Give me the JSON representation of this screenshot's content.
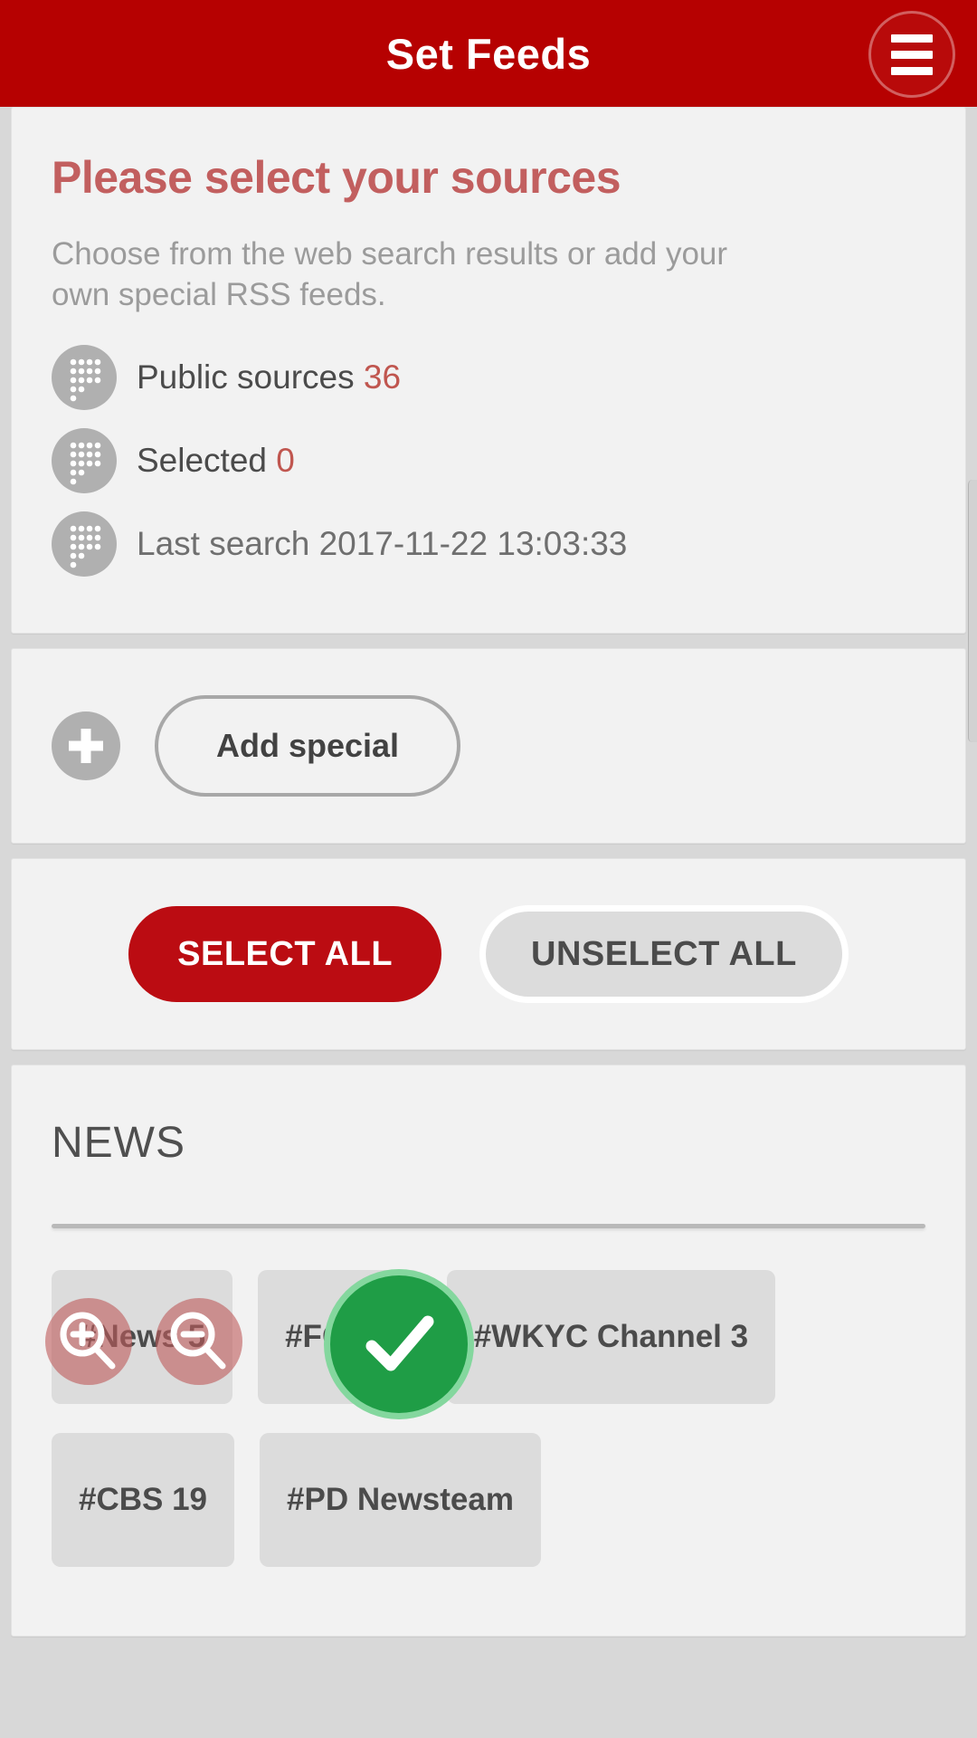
{
  "header": {
    "title": "Set Feeds",
    "menu_icon": "hamburger-menu-icon"
  },
  "intro": {
    "headline": "Please select your sources",
    "subtext": "Choose from the web search results or add your own special RSS feeds.",
    "stats": [
      {
        "icon": "dot-matrix-icon",
        "label": "Public sources",
        "value": "36",
        "value_is_accent": true
      },
      {
        "icon": "dot-matrix-icon",
        "label": "Selected",
        "value": "0",
        "value_is_accent": true
      },
      {
        "icon": "dot-matrix-icon",
        "label": "Last search",
        "value": "2017-11-22 13:03:33",
        "value_is_accent": false
      }
    ]
  },
  "add_special": {
    "plus_icon": "plus-icon",
    "label": "Add special"
  },
  "actions": {
    "select_all_label": "SELECT ALL",
    "unselect_all_label": "UNSELECT ALL"
  },
  "groups": [
    {
      "title": "NEWS",
      "chips": [
        [
          "#News 5",
          "#FOX 8",
          "#WKYC Channel 3"
        ],
        [
          "#CBS 19",
          "#PD Newsteam"
        ]
      ]
    }
  ],
  "overlay": {
    "zoom_in_icon": "magnifier-plus-icon",
    "zoom_out_icon": "magnifier-minus-icon",
    "confirm_icon": "check-icon"
  },
  "colors": {
    "appbar": "#b60101",
    "accent_red": "#c0564f",
    "primary_button": "#bb0c12",
    "confirm_green": "#1f9d46",
    "card_bg": "#f2f2f2",
    "page_bg": "#d8d8d8"
  }
}
